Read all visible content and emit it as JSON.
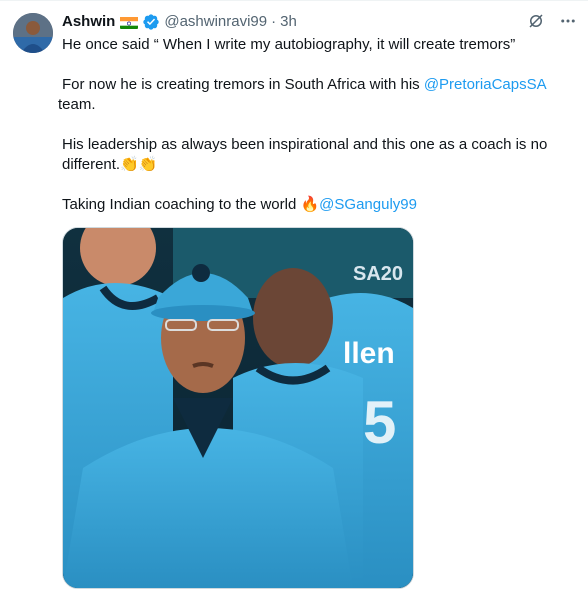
{
  "tweet": {
    "author_name": "Ashwin",
    "flag_icon": "india-flag-icon",
    "verified_icon": "verified-badge-icon",
    "handle": "@ashwinravi99",
    "separator": "·",
    "timestamp": "3h",
    "paragraphs": {
      "p1": "He once said “ When I write my autobiography, it will create tremors”",
      "p2_prefix": "For now he is creating tremors in South Africa with his ",
      "p2_mention": "@PretoriaCapsSA",
      "p2_suffix": " team.",
      "p3_text": "His leadership as always been inspirational and this one as a coach is no different.",
      "p3_emoji": "👏👏",
      "p4_text": "Taking Indian coaching to the world ",
      "p4_emoji": "🔥",
      "p4_mention": "@SGanguly99"
    },
    "media": {
      "jersey_text": "llen",
      "board_text": "SA20",
      "cap_logo": "pretoria-capitals-cap-logo"
    }
  },
  "icons": {
    "grok": "grok-icon",
    "more": "more-options-icon"
  },
  "colors": {
    "accent": "#1d9bf0",
    "secondary_text": "#536471",
    "jersey_blue": "#3aa7d8"
  }
}
